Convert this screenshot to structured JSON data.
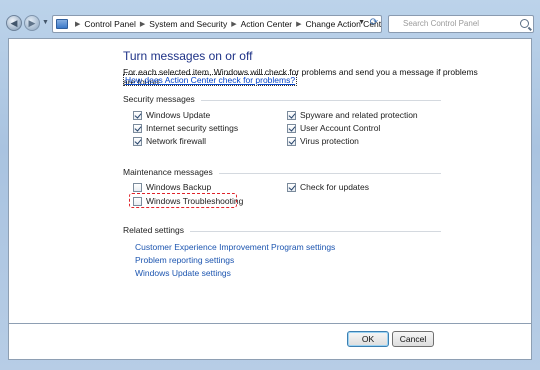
{
  "navbar": {
    "breadcrumbs": [
      "Control Panel",
      "System and Security",
      "Action Center",
      "Change Action Center settings"
    ],
    "search_placeholder": "Search Control Panel"
  },
  "page": {
    "title": "Turn messages on or off",
    "intro": "For each selected item, Windows will check for problems and send you a message if problems are found.",
    "intro_link": "How does Action Center check for problems?"
  },
  "security": {
    "title": "Security messages",
    "items": [
      {
        "label": "Windows Update",
        "checked": true
      },
      {
        "label": "Internet security settings",
        "checked": true
      },
      {
        "label": "Network firewall",
        "checked": true
      },
      {
        "label": "Spyware and related protection",
        "checked": true
      },
      {
        "label": "User Account Control",
        "checked": true
      },
      {
        "label": "Virus protection",
        "checked": true
      }
    ]
  },
  "maintenance": {
    "title": "Maintenance messages",
    "items": [
      {
        "label": "Windows Backup",
        "checked": false
      },
      {
        "label": "Windows Troubleshooting",
        "checked": false
      },
      {
        "label": "Check for updates",
        "checked": true
      }
    ]
  },
  "related": {
    "title": "Related settings",
    "links": [
      "Customer Experience Improvement Program settings",
      "Problem reporting settings",
      "Windows Update settings"
    ]
  },
  "footer": {
    "ok": "OK",
    "cancel": "Cancel"
  }
}
